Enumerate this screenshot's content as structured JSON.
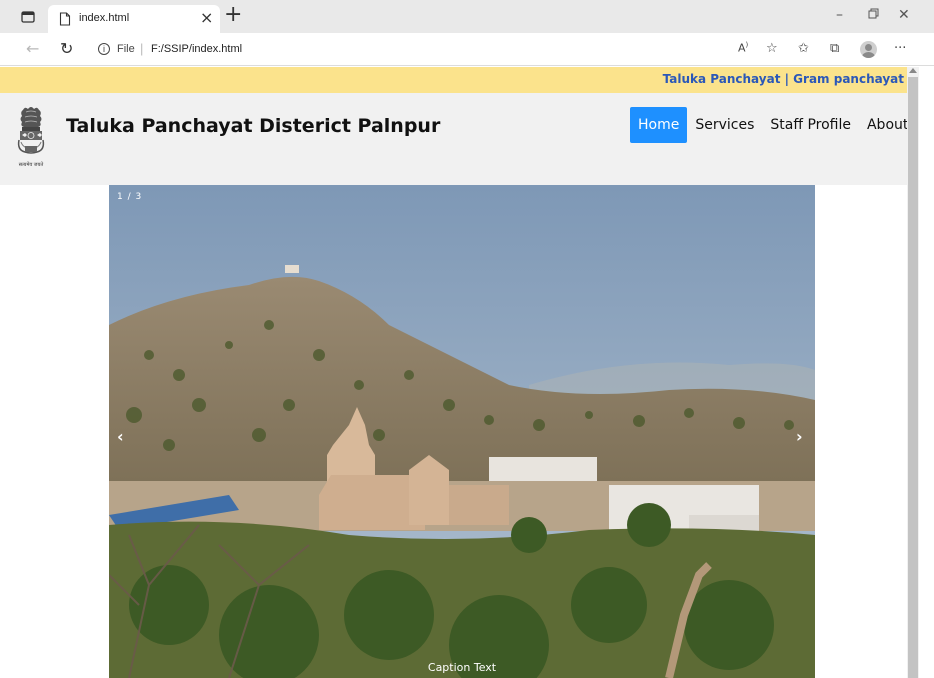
{
  "browser": {
    "tab_title": "index.html",
    "tab_close": "×",
    "new_tab": "+",
    "url_scheme": "File",
    "url_separator": "|",
    "url_path": "F:/SSIP/index.html",
    "more_menu": "···"
  },
  "site": {
    "top_links": "Taluka Panchayat | Gram panchayat",
    "title": "Taluka Panchayat Disterict Palnpur",
    "emblem_motto": "सत्यमेव जयते",
    "nav": [
      {
        "label": "Home",
        "active": true
      },
      {
        "label": "Services",
        "active": false
      },
      {
        "label": "Staff Profile",
        "active": false
      },
      {
        "label": "About",
        "active": false
      }
    ]
  },
  "slideshow": {
    "counter": "1 / 3",
    "prev": "‹",
    "next": "›",
    "caption": "Caption Text"
  },
  "colors": {
    "top_strip": "#fbe38c",
    "top_link_text": "#2b58b8",
    "header_bg": "#f1f1f1",
    "nav_active": "#1e90ff"
  }
}
